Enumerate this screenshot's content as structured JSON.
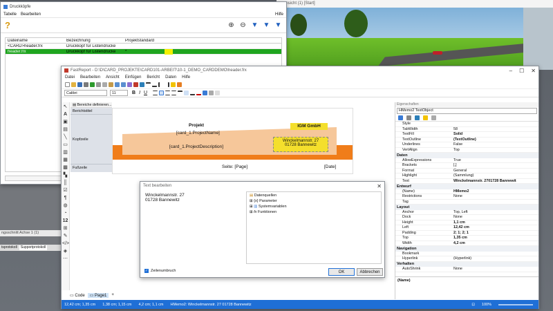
{
  "background_window": {
    "title_fragment": "ansicht (1) [Start]",
    "tab1": "tsprotokoll",
    "tab2": "Supportprotokoll",
    "axis_label": "ngsschnitt Achse 1 (1)"
  },
  "druckkoepfe": {
    "title": "Druckköpfe",
    "menu": [
      "Tabelle",
      "Bearbeiten"
    ],
    "help": "Hilfe",
    "help_icon": "?",
    "columns": [
      "Dateiname",
      "Bezeichnung",
      "Projektstandard"
    ],
    "rows": [
      {
        "file": "<CARD>header.frx",
        "desc": "Druckkopf für Listendrucke",
        "std": ""
      },
      {
        "file": "header.frx",
        "desc": "Druckkopf für Listendrucke",
        "std": "*"
      }
    ]
  },
  "fastreport": {
    "title": "FastReport - D:\\D\\CARD_PROJEKTE\\CARD101-ARBEIT\\10-1_DEMO_CARDDEMO\\header.frx",
    "menu": [
      "Datei",
      "Bearbeiten",
      "Ansicht",
      "Einfügen",
      "Bericht",
      "Daten",
      "Hilfe"
    ],
    "font_name": "Calibri",
    "font_size": "11",
    "bands_header": "Bereiche definieren...",
    "bands": [
      "Berichtstitel",
      "Kopfzeile",
      "Fußzeile"
    ],
    "report": {
      "projekt": "Projekt",
      "project_name": "[card_1.ProjectName]",
      "project_desc": "[card_1.ProjectDescription]",
      "company": "IGM GmbH",
      "address": "Winckelmannstr. 27\n01728 Bannewitz",
      "page": "Seite: [Page]",
      "date": "[Date]"
    },
    "bottom_tabs": [
      "Code",
      "Page1"
    ],
    "status": {
      "pos1": "12,42 cm; 1,35 cm",
      "pos2": "1,38 cm; 1,15 cm",
      "pos3": "4,2 cm; 1,1 cm",
      "text": "HMemo2: Winckelmannstr. 27 01728 Bannewitz",
      "zoom": "100%"
    }
  },
  "properties": {
    "title": "Eigenschaften",
    "object": "HMemo2 TextObject",
    "rows": [
      {
        "type": "prop",
        "name": "Style",
        "value": ""
      },
      {
        "type": "prop",
        "name": "TabWidth",
        "value": "58"
      },
      {
        "type": "prop",
        "name": "TextFill",
        "value": "Solid",
        "bold": true
      },
      {
        "type": "prop",
        "name": "TextOutline",
        "value": "(TextOutline)",
        "bold": true
      },
      {
        "type": "prop",
        "name": "Underlines",
        "value": "False"
      },
      {
        "type": "prop",
        "name": "VertAlign",
        "value": "Top"
      },
      {
        "type": "cat",
        "name": "Daten"
      },
      {
        "type": "prop",
        "name": "AllowExpressions",
        "value": "True"
      },
      {
        "type": "prop",
        "name": "Brackets",
        "value": "[,]"
      },
      {
        "type": "prop",
        "name": "Format",
        "value": "General"
      },
      {
        "type": "prop",
        "name": "Highlight",
        "value": "(Sammlung)"
      },
      {
        "type": "prop",
        "name": "Text",
        "value": "Winckelmannstr. 2701728 Bannewit",
        "bold": true
      },
      {
        "type": "cat",
        "name": "Entwurf"
      },
      {
        "type": "prop",
        "name": "(Name)",
        "value": "HMemo2",
        "bold": true
      },
      {
        "type": "prop",
        "name": "Restrictions",
        "value": "None"
      },
      {
        "type": "prop",
        "name": "Tag",
        "value": ""
      },
      {
        "type": "cat",
        "name": "Layout"
      },
      {
        "type": "prop",
        "name": "Anchor",
        "value": "Top, Left"
      },
      {
        "type": "prop",
        "name": "Dock",
        "value": "None"
      },
      {
        "type": "prop",
        "name": "Height",
        "value": "1,1 cm",
        "bold": true
      },
      {
        "type": "prop",
        "name": "Left",
        "value": "12,42 cm",
        "bold": true
      },
      {
        "type": "prop",
        "name": "Padding",
        "value": "2; 1; 2; 1",
        "bold": true
      },
      {
        "type": "prop",
        "name": "Top",
        "value": "1,35 cm",
        "bold": true
      },
      {
        "type": "prop",
        "name": "Width",
        "value": "4,2 cm",
        "bold": true
      },
      {
        "type": "cat",
        "name": "Navigation"
      },
      {
        "type": "prop",
        "name": "Bookmark",
        "value": ""
      },
      {
        "type": "prop",
        "name": "Hyperlink",
        "value": "(Hyperlink)"
      },
      {
        "type": "cat",
        "name": "Verhalten"
      },
      {
        "type": "prop",
        "name": "AutoShrink",
        "value": "None"
      }
    ],
    "footer": "(Name)"
  },
  "text_dialog": {
    "title": "Text bearbeiten",
    "text": "Winckelmannstr. 27\n01728 Bannewitz",
    "tree": [
      {
        "label": "Datenquellen",
        "indent": 0
      },
      {
        "label": "Parameter",
        "indent": 0
      },
      {
        "label": "Systemvariablen",
        "indent": 0
      },
      {
        "label": "Funktionen",
        "indent": 0
      }
    ],
    "wrap_label": "Zeilenumbruch",
    "ok": "OK",
    "cancel": "Abbrechen"
  }
}
